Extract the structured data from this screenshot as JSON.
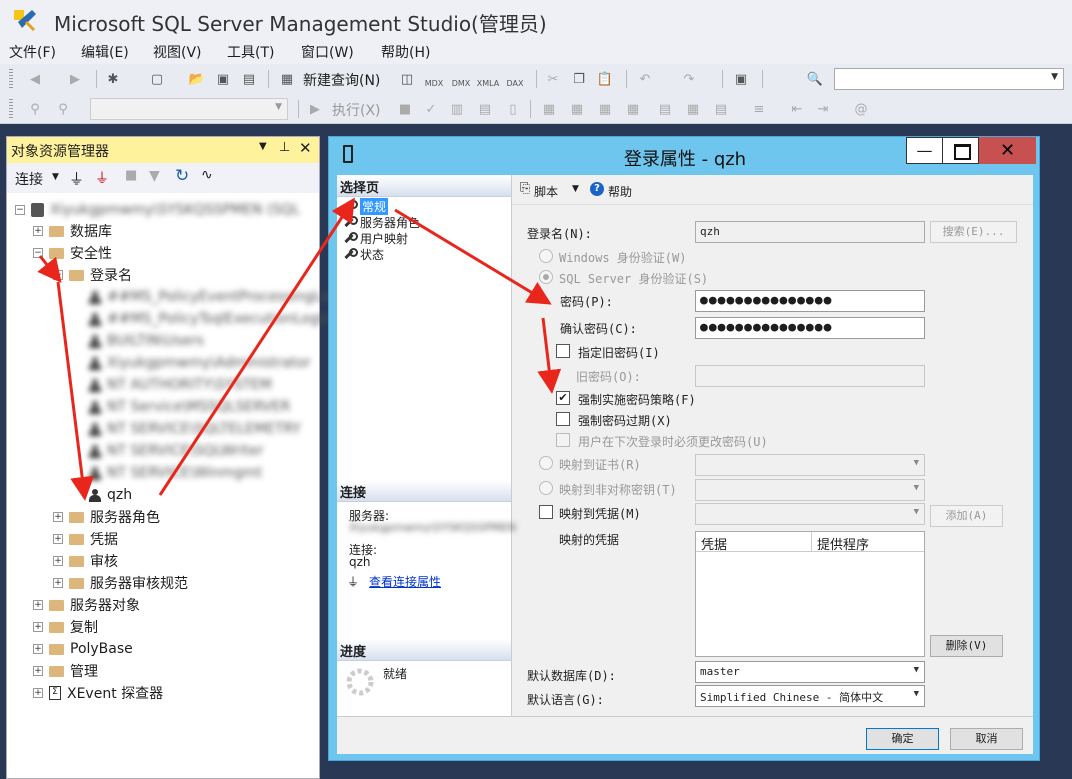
{
  "app": {
    "title": "Microsoft SQL Server Management Studio(管理员)"
  },
  "menu": [
    "文件(F)",
    "编辑(E)",
    "视图(V)",
    "工具(T)",
    "窗口(W)",
    "帮助(H)"
  ],
  "toolbar": {
    "new_query": "新建查询(N)",
    "mdx": "MDX",
    "dmx": "DMX",
    "xmla": "XMLA",
    "dax": "DAX",
    "execute": "执行(X)"
  },
  "object_explorer": {
    "title": "对象资源管理器",
    "connect": "连接",
    "tree": {
      "server": "Xiyukgpmwmy\\SYSKQSSPMEN (SQL",
      "databases": "数据库",
      "security": "安全性",
      "logins": "登录名",
      "login_items": [
        "##MS_PolicyEventProcessingLogin##",
        "##MS_PolicyTsqlExecutionLogin##",
        "BUILTIN\\Users",
        "Xiyukgpmwmy\\Administrator",
        "NT AUTHORITY\\SYSTEM",
        "NT Service\\MSSQLSERVER",
        "NT SERVICE\\SQLTELEMETRY",
        "NT SERVICE\\SQLWriter",
        "NT SERVICE\\Winmgmt"
      ],
      "selected_login": "qzh",
      "server_roles": "服务器角色",
      "credentials": "凭据",
      "audits": "审核",
      "audit_specs": "服务器审核规范",
      "server_objects": "服务器对象",
      "replication": "复制",
      "polybase": "PolyBase",
      "management": "管理",
      "xevent": "XEvent 探查器"
    }
  },
  "dialog": {
    "title": "登录属性 - qzh",
    "select_page": "选择页",
    "pages": [
      "常规",
      "服务器角色",
      "用户映射",
      "状态"
    ],
    "connection_header": "连接",
    "server_label": "服务器:",
    "server_value": "Xiyukgpmwmy\\SYSKQSSPMEN",
    "connect_label": "连接:",
    "connect_value": "qzh",
    "view_conn": "查看连接属性",
    "progress_header": "进度",
    "progress_status": "就绪",
    "script": "脚本",
    "help": "帮助",
    "login_name_label": "登录名(N):",
    "login_name": "qzh",
    "search": "搜索(E)...",
    "windows_auth": "Windows 身份验证(W)",
    "sql_auth": "SQL Server 身份验证(S)",
    "password_label": "密码(P):",
    "password_mask": "●●●●●●●●●●●●●●●",
    "confirm_label": "确认密码(C):",
    "specify_old": "指定旧密码(I)",
    "old_password_label": "旧密码(O):",
    "enforce_policy": "强制实施密码策略(F)",
    "enforce_expiry": "强制密码过期(X)",
    "must_change": "用户在下次登录时必须更改密码(U)",
    "map_cert": "映射到证书(R)",
    "map_asym": "映射到非对称密钥(T)",
    "map_cred": "映射到凭据(M)",
    "add": "添加(A)",
    "mapped_creds": "映射的凭据",
    "col_cred": "凭据",
    "col_provider": "提供程序",
    "remove": "删除(V)",
    "default_db_label": "默认数据库(D):",
    "default_db": "master",
    "default_lang_label": "默认语言(G):",
    "default_lang": "Simplified Chinese - 简体中文",
    "ok": "确定",
    "cancel": "取消"
  },
  "colors": {
    "accent_yellow": "#fff29d",
    "dialog_frame": "#6ec6ee",
    "annotation_red": "#e8261c"
  }
}
